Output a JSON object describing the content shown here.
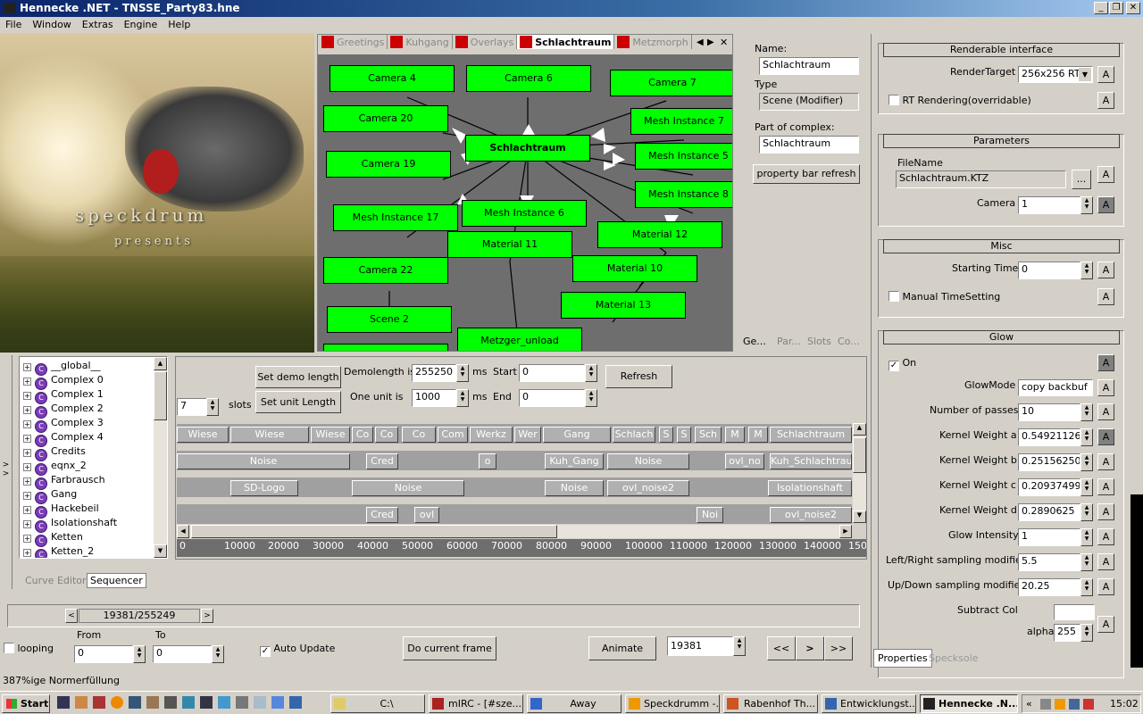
{
  "window": {
    "title": "Hennecke .NET - TNSSE_Party83.hne",
    "min": "_",
    "max": "❐",
    "close": "✕"
  },
  "menu": [
    "File",
    "Window",
    "Extras",
    "Engine",
    "Help"
  ],
  "preview": {
    "text1": "speckdrum",
    "text2": "presents"
  },
  "graph": {
    "tabs": [
      "Greetings",
      "Kuhgang",
      "Overlays",
      "Schlachtraum",
      "Metzmorph"
    ],
    "active_tab": "Schlachtraum",
    "nodes": [
      "Camera 4",
      "Camera 6",
      "Camera 7",
      "Camera 20",
      "Schlachtraum",
      "Mesh Instance 7",
      "Camera 19",
      "Mesh Instance 5",
      "Mesh Instance 8",
      "Mesh Instance 17",
      "Mesh Instance 6",
      "Material 11",
      "Material 12",
      "Camera 22",
      "Material 10",
      "Material 13",
      "Scene 2",
      "Metzger_unload"
    ]
  },
  "props": {
    "name_label": "Name:",
    "name_value": "Schlachtraum",
    "type_label": "Type",
    "type_value": "Scene (Modifier)",
    "complex_label": "Part of complex:",
    "complex_value": "Schlachtraum",
    "refresh": "property bar refresh",
    "tabs": [
      "Ge...",
      "Par...",
      "Slots",
      "Co..."
    ]
  },
  "right": {
    "renderable": {
      "title": "Renderable interface",
      "rt_label": "RenderTarget",
      "rt_value": "256x256 RT",
      "rt_override": "RT Rendering(overridable)"
    },
    "params": {
      "title": "Parameters",
      "file_label": "FileName",
      "file_value": "Schlachtraum.KTZ",
      "browse": "...",
      "camera_label": "Camera",
      "camera_value": "1"
    },
    "misc": {
      "title": "Misc",
      "start_label": "Starting Time",
      "start_value": "0",
      "manual": "Manual TimeSetting"
    },
    "glow": {
      "title": "Glow",
      "on": "On",
      "mode_label": "GlowMode",
      "mode_value": "copy backbuf",
      "passes_label": "Number of passes",
      "passes_value": "10",
      "ka_label": "Kernel Weight a",
      "ka": "0.5492112636",
      "kb_label": "Kernel Weight b",
      "kb": "0.2515625055",
      "kc_label": "Kernel Weight c",
      "kc": "0.2093749940",
      "kd_label": "Kernel Weight d",
      "kd": "0.2890625",
      "intensity_label": "Glow Intensity",
      "intensity": "1",
      "lr_label": "Left/Right sampling modifier",
      "lr": "5.5",
      "ud_label": "Up/Down sampling modifier",
      "ud": "20.25",
      "subtract_label": "Subtract Col",
      "alpha_label": "alpha",
      "alpha": "255"
    },
    "a": "A",
    "bottom_tabs": [
      "Properties",
      "Specksole"
    ]
  },
  "tree": [
    "__global__",
    "Complex 0",
    "Complex 1",
    "Complex 2",
    "Complex 3",
    "Complex 4",
    "Credits",
    "eqnx_2",
    "Farbrausch",
    "Gang",
    "Hackebeil",
    "Isolationshaft",
    "Ketten",
    "Ketten_2"
  ],
  "seq": {
    "slots_value": "7",
    "slots_label": "slots",
    "set_demo": "Set demo length",
    "set_unit": "Set unit Length",
    "demolength_label": "Demolength is",
    "demolength": "255250",
    "ms": "ms",
    "unit_label": "One unit is",
    "unit": "1000",
    "start_label": "Start",
    "start": "0",
    "end_label": "End",
    "end": "0",
    "refresh": "Refresh",
    "row1": [
      "Wiese",
      "Wiese",
      "Wiese",
      "Co",
      "Co",
      "Co",
      "Com",
      "Werkz",
      "Wer",
      "Gang",
      "Schlach",
      "S",
      "S",
      "Sch",
      "M",
      "M",
      "Schlachtraum"
    ],
    "row2": [
      "Noise",
      "Cred",
      "o",
      "Kuh_Gang",
      "Noise",
      "ovl_no",
      "Kuh_Schlachtraum"
    ],
    "row3": [
      "SD-Logo",
      "Noise",
      "Noise",
      "ovl_noise2",
      "Isolationshaft"
    ],
    "row4": [
      "Cred",
      "ovl",
      "Noi",
      "ovl_noise2"
    ],
    "ruler": [
      "0",
      "10000",
      "20000",
      "30000",
      "40000",
      "50000",
      "60000",
      "70000",
      "80000",
      "90000",
      "100000",
      "110000",
      "120000",
      "130000",
      "140000",
      "150"
    ],
    "bottom_tabs": [
      "Curve Editor",
      "Sequencer"
    ]
  },
  "transport": {
    "position": "19381/255249",
    "prev": "<",
    "next": ">",
    "looping": "looping",
    "from_label": "From",
    "from": "0",
    "to_label": "To",
    "to": "0",
    "auto_update": "Auto Update",
    "do_frame": "Do current frame",
    "animate": "Animate",
    "frame": "19381",
    "rew": "<<",
    "play": ">",
    "ff": ">>"
  },
  "status": "387%ige Normerfüllung",
  "taskbar": {
    "start": "Start",
    "items": [
      "C:\\",
      "mIRC - [#sze...",
      "Away",
      "Speckdrumm -...",
      "Rabenhof Th...",
      "Entwicklungst...",
      "Hennecke .N..."
    ],
    "clock": "15:02",
    "tray_expand": "«"
  }
}
